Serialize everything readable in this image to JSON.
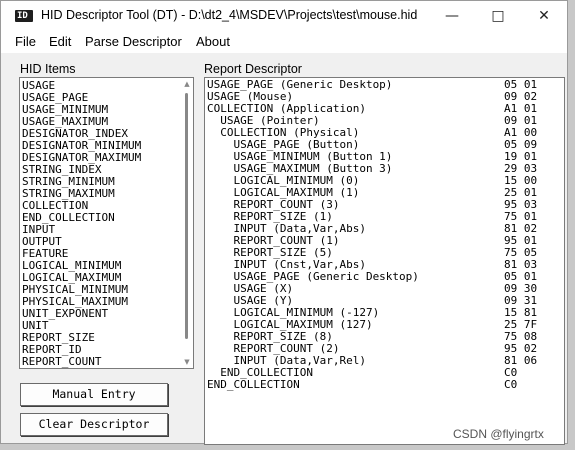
{
  "window": {
    "title": "HID Descriptor Tool (DT) - D:\\dt2_4\\MSDEV\\Projects\\test\\mouse.hid",
    "app_icon_label": "ID",
    "minimize_glyph": "—",
    "maximize_glyph": "□",
    "close_glyph": "✕"
  },
  "menu": [
    "File",
    "Edit",
    "Parse Descriptor",
    "About"
  ],
  "hid_items": {
    "label": "HID Items",
    "items": [
      "USAGE",
      "USAGE_PAGE",
      "USAGE_MINIMUM",
      "USAGE_MAXIMUM",
      "DESIGNATOR_INDEX",
      "DESIGNATOR_MINIMUM",
      "DESIGNATOR_MAXIMUM",
      "STRING_INDEX",
      "STRING_MINIMUM",
      "STRING_MAXIMUM",
      "COLLECTION",
      "END_COLLECTION",
      "INPUT",
      "OUTPUT",
      "FEATURE",
      "LOGICAL_MINIMUM",
      "LOGICAL_MAXIMUM",
      "PHYSICAL_MINIMUM",
      "PHYSICAL_MAXIMUM",
      "UNIT_EXPONENT",
      "UNIT",
      "REPORT_SIZE",
      "REPORT_ID",
      "REPORT_COUNT"
    ],
    "scroll_up_glyph": "▲",
    "scroll_down_glyph": "▼"
  },
  "buttons": {
    "manual_entry": "Manual Entry",
    "clear_descriptor": "Clear Descriptor"
  },
  "report_descriptor": {
    "label": "Report Descriptor",
    "rows": [
      {
        "text": "USAGE_PAGE (Generic Desktop)",
        "hex": "05 01"
      },
      {
        "text": "USAGE (Mouse)",
        "hex": "09 02"
      },
      {
        "text": "COLLECTION (Application)",
        "hex": "A1 01"
      },
      {
        "text": "  USAGE (Pointer)",
        "hex": "09 01"
      },
      {
        "text": "  COLLECTION (Physical)",
        "hex": "A1 00"
      },
      {
        "text": "    USAGE_PAGE (Button)",
        "hex": "05 09"
      },
      {
        "text": "    USAGE_MINIMUM (Button 1)",
        "hex": "19 01"
      },
      {
        "text": "    USAGE_MAXIMUM (Button 3)",
        "hex": "29 03"
      },
      {
        "text": "    LOGICAL_MINIMUM (0)",
        "hex": "15 00"
      },
      {
        "text": "    LOGICAL_MAXIMUM (1)",
        "hex": "25 01"
      },
      {
        "text": "    REPORT_COUNT (3)",
        "hex": "95 03"
      },
      {
        "text": "    REPORT_SIZE (1)",
        "hex": "75 01"
      },
      {
        "text": "    INPUT (Data,Var,Abs)",
        "hex": "81 02"
      },
      {
        "text": "    REPORT_COUNT (1)",
        "hex": "95 01"
      },
      {
        "text": "    REPORT_SIZE (5)",
        "hex": "75 05"
      },
      {
        "text": "    INPUT (Cnst,Var,Abs)",
        "hex": "81 03"
      },
      {
        "text": "    USAGE_PAGE (Generic Desktop)",
        "hex": "05 01"
      },
      {
        "text": "    USAGE (X)",
        "hex": "09 30"
      },
      {
        "text": "    USAGE (Y)",
        "hex": "09 31"
      },
      {
        "text": "    LOGICAL_MINIMUM (-127)",
        "hex": "15 81"
      },
      {
        "text": "    LOGICAL_MAXIMUM (127)",
        "hex": "25 7F"
      },
      {
        "text": "    REPORT_SIZE (8)",
        "hex": "75 08"
      },
      {
        "text": "    REPORT_COUNT (2)",
        "hex": "95 02"
      },
      {
        "text": "    INPUT (Data,Var,Rel)",
        "hex": "81 06"
      },
      {
        "text": "  END_COLLECTION",
        "hex": "C0"
      },
      {
        "text": "END_COLLECTION",
        "hex": "C0"
      }
    ]
  },
  "watermark": "CSDN @flyingrtx"
}
